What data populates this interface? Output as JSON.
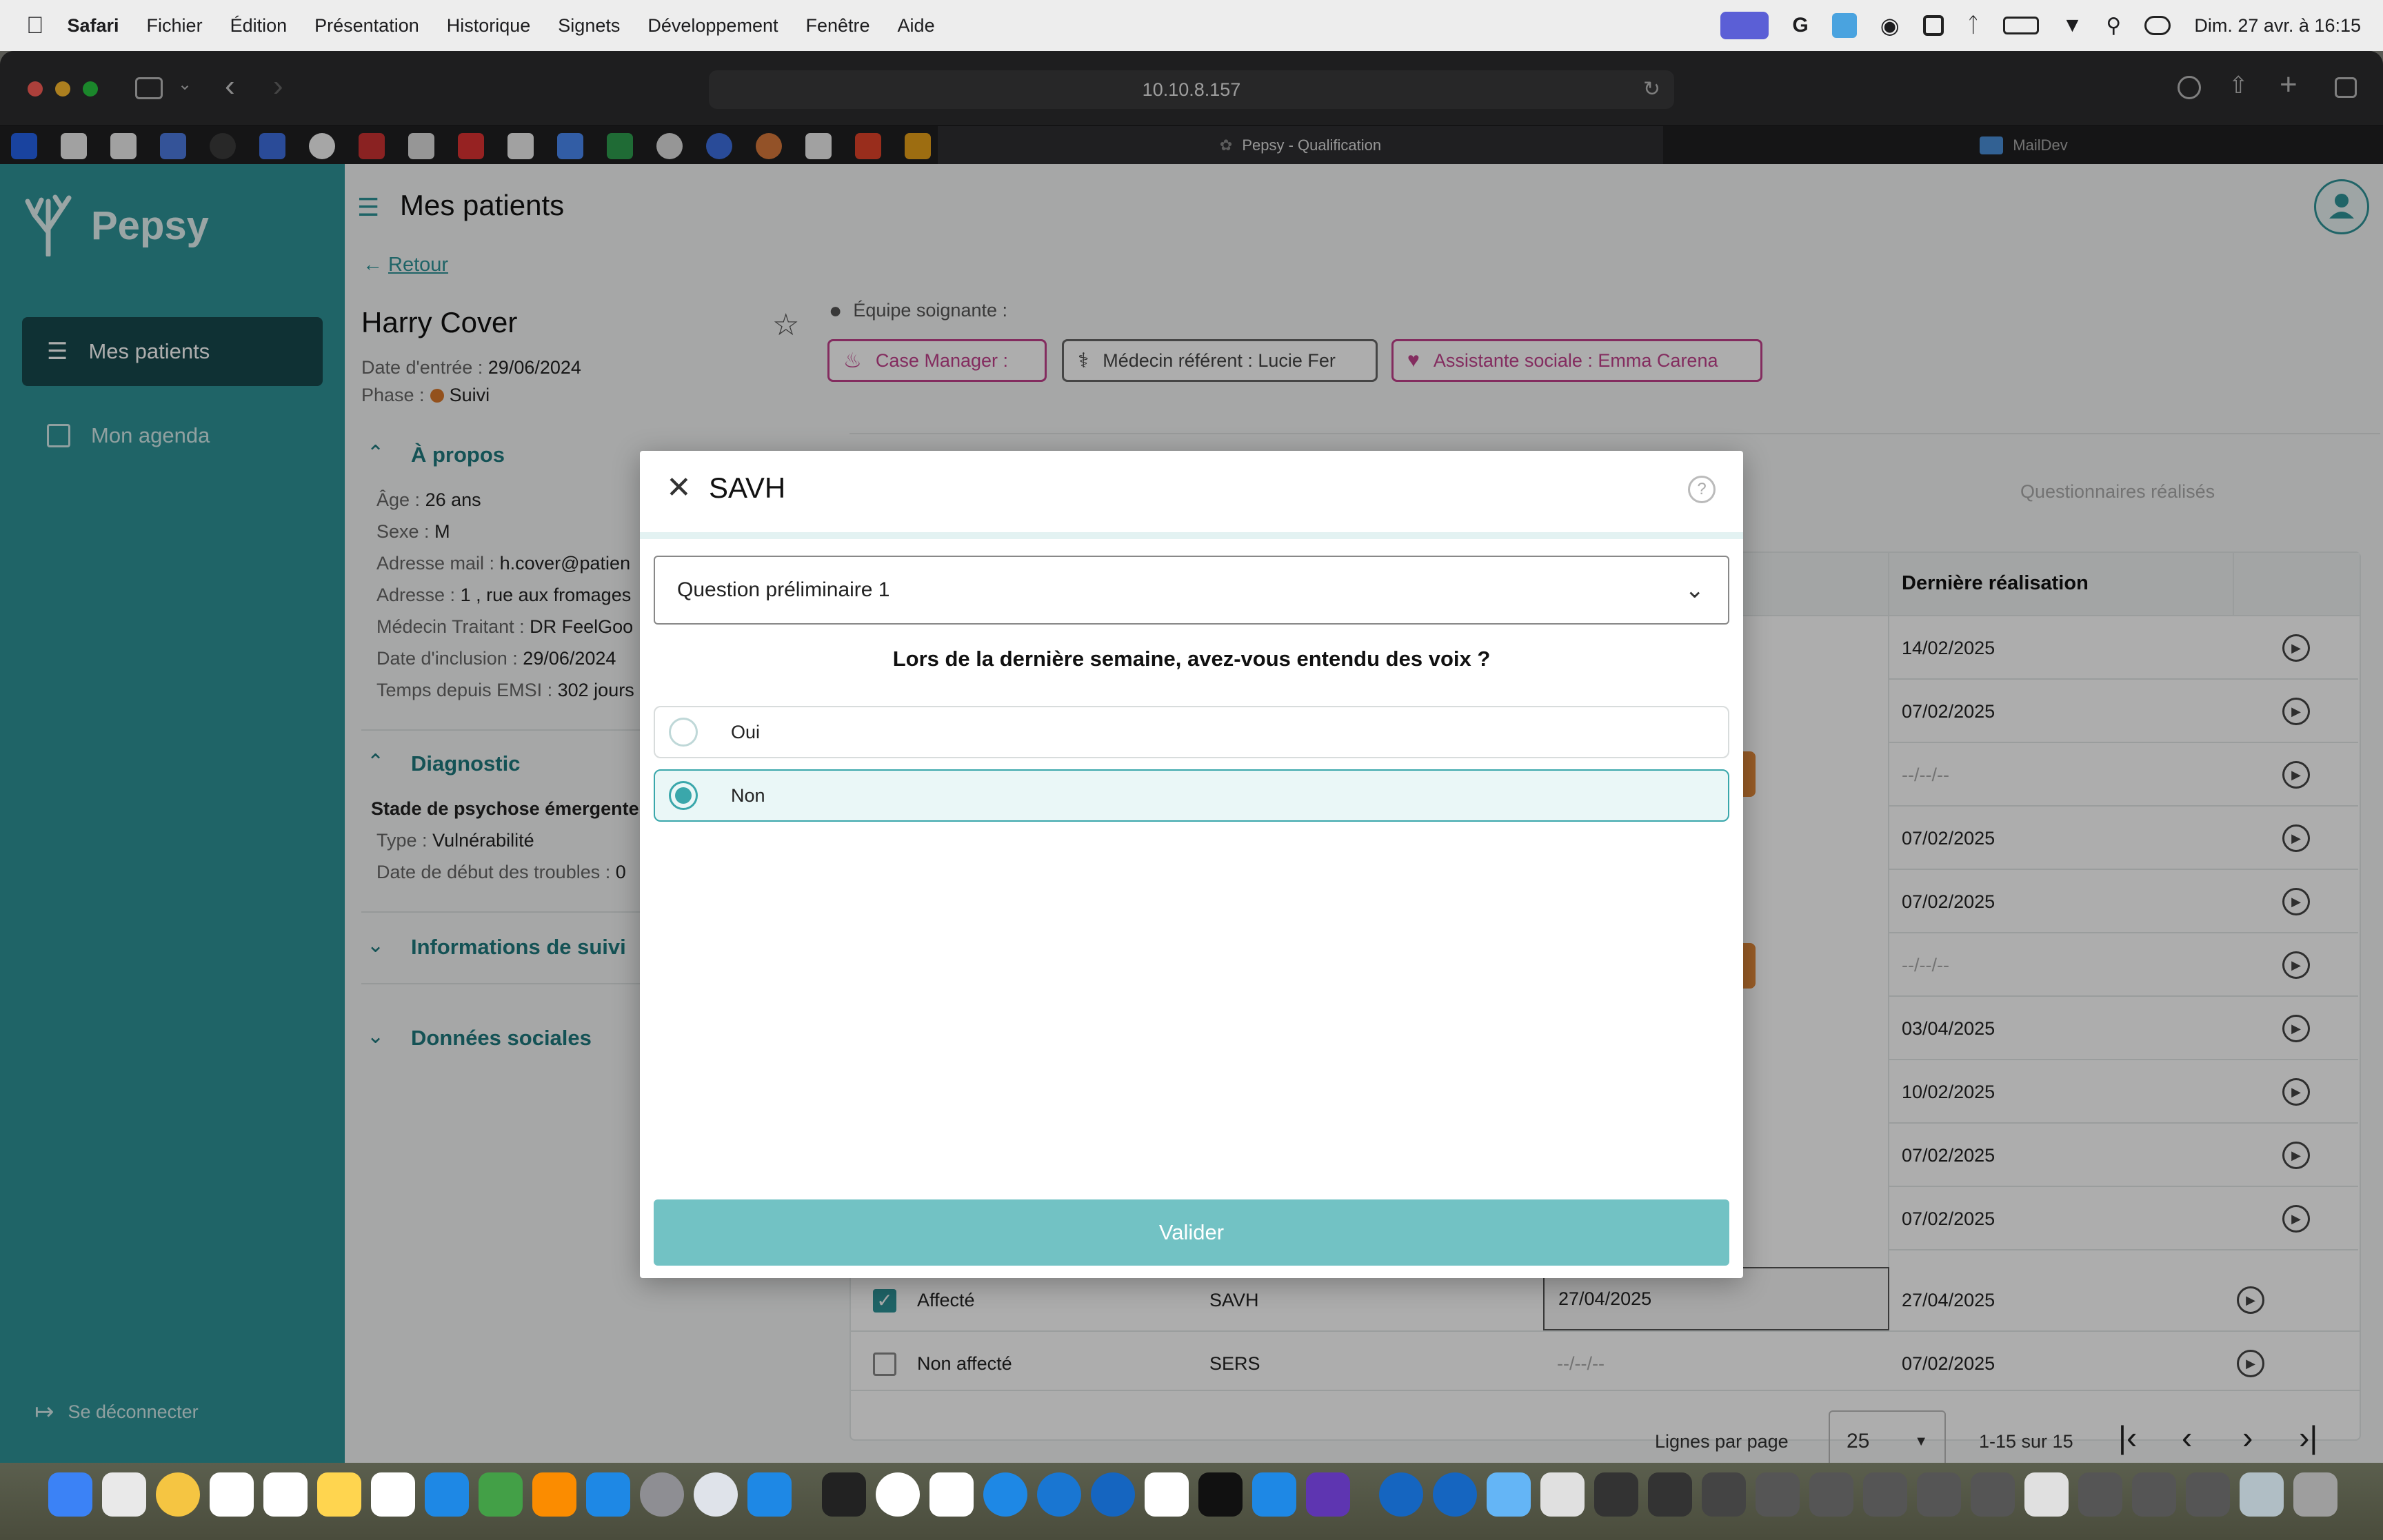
{
  "menubar": {
    "app": "Safari",
    "items": [
      "Fichier",
      "Édition",
      "Présentation",
      "Historique",
      "Signets",
      "Développement",
      "Fenêtre",
      "Aide"
    ],
    "clock": "Dim. 27 avr. à 16:15"
  },
  "browser": {
    "url": "10.10.8.157",
    "tabs": [
      {
        "label": "Pepsy - Qualification"
      },
      {
        "label": "MailDev"
      }
    ]
  },
  "sidebar": {
    "brand": "Pepsy",
    "items": [
      {
        "label": "Mes patients"
      },
      {
        "label": "Mon agenda"
      }
    ],
    "logout": "Se déconnecter"
  },
  "header": {
    "title": "Mes patients"
  },
  "back": "Retour",
  "patient": {
    "name": "Harry Cover",
    "entry_label": "Date d'entrée :",
    "entry": "29/06/2024",
    "phase_label": "Phase :",
    "phase": "Suivi"
  },
  "team": {
    "label": "Équipe soignante :",
    "case_manager": "Case Manager :",
    "medecin": "Médecin référent : Lucie Fer",
    "assistante": "Assistante sociale : Emma Carena"
  },
  "about": {
    "title": "À propos",
    "fields": [
      {
        "label": "Âge :",
        "value": "26 ans"
      },
      {
        "label": "Sexe :",
        "value": "M"
      },
      {
        "label": "Adresse mail :",
        "value": "h.cover@patien"
      },
      {
        "label": "Adresse :",
        "value": "1 , rue aux fromages"
      },
      {
        "label": "Médecin Traitant :",
        "value": "DR FeelGoo"
      },
      {
        "label": "Date d'inclusion :",
        "value": "29/06/2024"
      },
      {
        "label": "Temps depuis EMSI :",
        "value": "302 jours"
      }
    ]
  },
  "diagnostic": {
    "title": "Diagnostic",
    "stage": "Stade de psychose émergente",
    "type_label": "Type :",
    "type": "Vulnérabilité",
    "start_label": "Date de début des troubles :",
    "start": "0"
  },
  "sections": {
    "suivi": "Informations de suivi",
    "sociales": "Données sociales"
  },
  "table": {
    "tab_done": "Questionnaires réalisés",
    "col_last": "Dernière réalisation",
    "last_dates": [
      "14/02/2025",
      "07/02/2025",
      "--/--/--",
      "07/02/2025",
      "07/02/2025",
      "--/--/--",
      "03/04/2025",
      "10/02/2025",
      "07/02/2025",
      "07/02/2025"
    ],
    "rows": [
      {
        "status": "Affecté",
        "name": "SAVH",
        "date": "27/04/2025",
        "last": "27/04/2025"
      },
      {
        "status": "Non affecté",
        "name": "SERS",
        "date": "--/--/--",
        "last": "07/02/2025"
      }
    ],
    "footer": {
      "rows_label": "Lignes par page",
      "rows_value": "25",
      "range": "1-15 sur 15"
    }
  },
  "modal": {
    "title": "SAVH",
    "select": "Question préliminaire 1",
    "question": "Lors de la dernière semaine, avez-vous entendu des voix ?",
    "options": [
      {
        "label": "Oui",
        "selected": false
      },
      {
        "label": "Non",
        "selected": true
      }
    ],
    "submit": "Valider"
  },
  "colors": {
    "sidebar": "#2f9499",
    "accent": "#3aa7ab",
    "pink": "#c2418c",
    "submit": "#72c2c4"
  }
}
